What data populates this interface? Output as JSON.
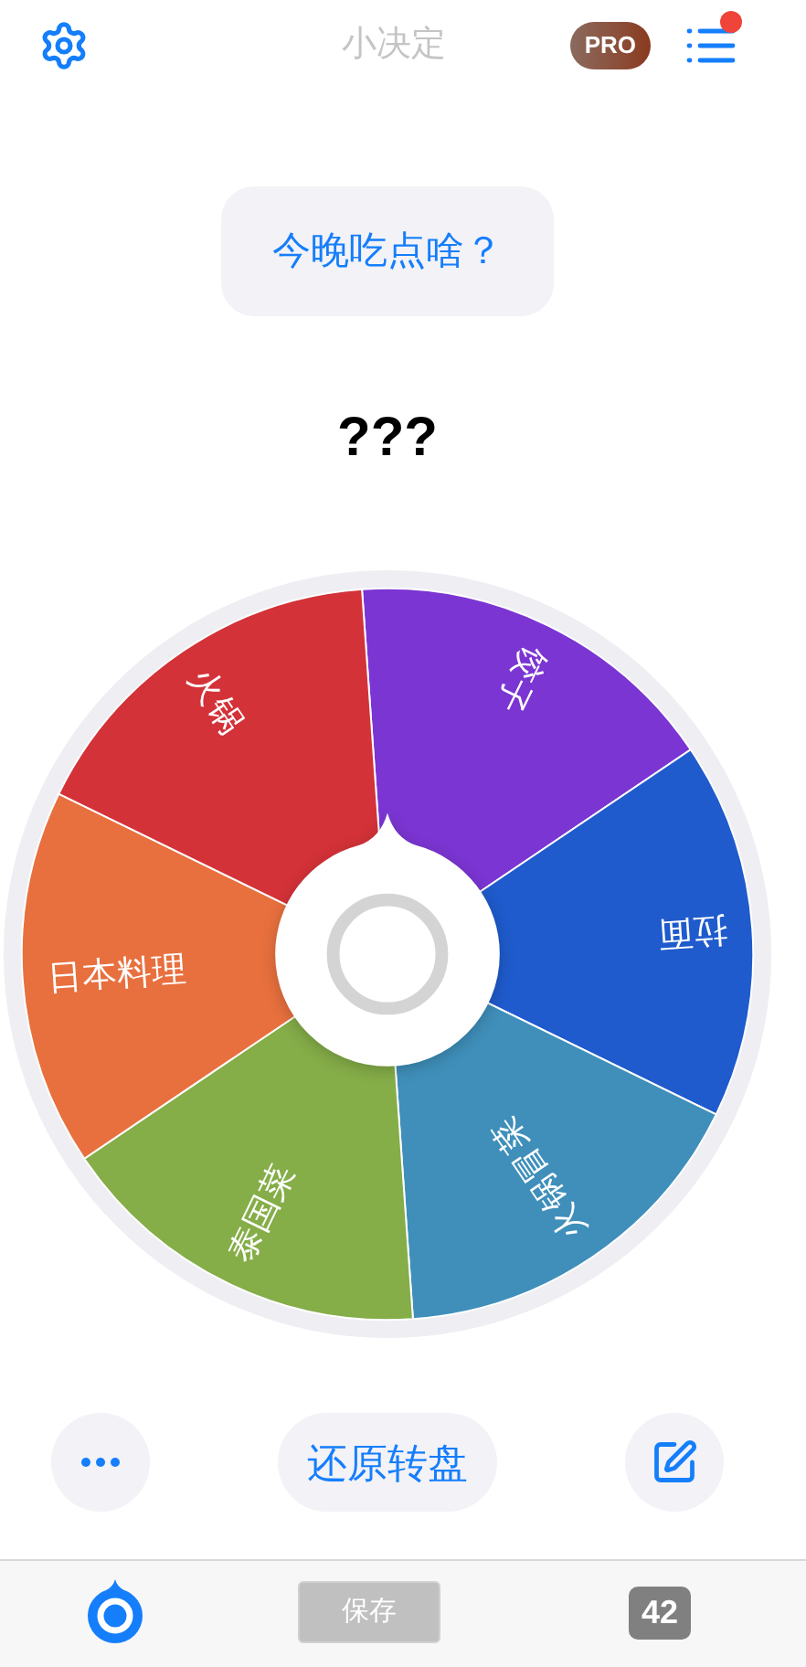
{
  "header": {
    "title": "小决定",
    "badge": "PRO",
    "menu_notification": true
  },
  "question": "今晚吃点啥？",
  "result": "???",
  "wheel": {
    "segments": [
      {
        "label": "饺子",
        "color": "#7b35d2"
      },
      {
        "label": "拉面",
        "color": "#1f5bcc"
      },
      {
        "label": "火锅冒菜",
        "color": "#3f8fba"
      },
      {
        "label": "泰国菜",
        "color": "#85ad48"
      },
      {
        "label": "日本料理",
        "color": "#e8703e"
      },
      {
        "label": "火锅",
        "color": "#d33238"
      }
    ]
  },
  "actions": {
    "reset_button": "还原转盘"
  },
  "tab_bar": {
    "save_button": "保存",
    "count": "42"
  }
}
